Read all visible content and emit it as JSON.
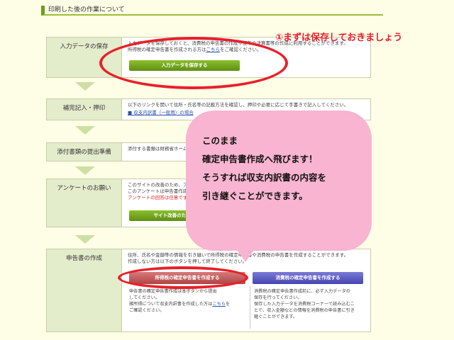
{
  "header": {
    "title": "印刷した後の作業について"
  },
  "annotation": "①まずは保存しておきましょう",
  "steps": [
    {
      "label": "入力データの保存",
      "text1": "入力データを保存しておくと、消費税の申告書の作成や翌年の決算書等の作成に利用することができます。",
      "text2_pre": "所得税の確定申告書を作成される方は",
      "text2_link": "こちら",
      "text2_post": "をご確認ください。",
      "button": "入力データを保存する"
    },
    {
      "label": "補完記入・押印",
      "text1": "以下のリンクを開いて住所・氏名等の記載方法を確認し、押印や必要に応じて手書きで記入してください。",
      "link": "■ 収支内訳書（一般用）の場合"
    },
    {
      "label": "添付書類の提出準備",
      "text1": "添付する書類は財務省ホームページでご確認ください。"
    },
    {
      "label": "アンケートのお願い",
      "text1": "このサイトの改善のため、アンケートにご協力ください。",
      "text2": "このアンケートは申告書作成の",
      "text3": "アンケートの回答は任意です",
      "button": "サイト改善のためのアンケート"
    },
    {
      "label": "申告書の作成",
      "text1": "住所、氏名や金額等の情報を引き継いで所得税の確定申告書や消費税の申告書を作成することができます。",
      "text2": "作成しない方は以下のボタンを押して終了してください。",
      "button_left": "所得税の確定申告書を作成する",
      "button_right": "消費税の確定申告書を作成する",
      "left_text1": "申告書の確定申告書作成は本ボタンから提出",
      "left_text2": "してください。",
      "left_text3_pre": "雑所得について収支内訳書を作成した方は",
      "left_text3_link": "こちら",
      "left_text3_post": "を",
      "left_text4": "ご確認ください。",
      "right_text1": "消費税の確定申告書作成前に、必ず入力データの",
      "right_text2": "保存を行ってください。",
      "right_text3": "保存した入力データを消費税コーナーで読み込むこ",
      "right_text4": "とで、収入金額などの情報を消費税の申告書に引き",
      "right_text5": "継ぐことができます。"
    }
  ],
  "bubble": {
    "line1": "このまま",
    "line2": "確定申告書作成へ飛びます！",
    "line3": "そうすれば収支内訳書の内容を",
    "line4": "引き継ぐことができます。"
  },
  "colors": {
    "annotation": "#e8202a",
    "bubble": "#f8b4d0",
    "label_bg": "#e3eccb"
  }
}
